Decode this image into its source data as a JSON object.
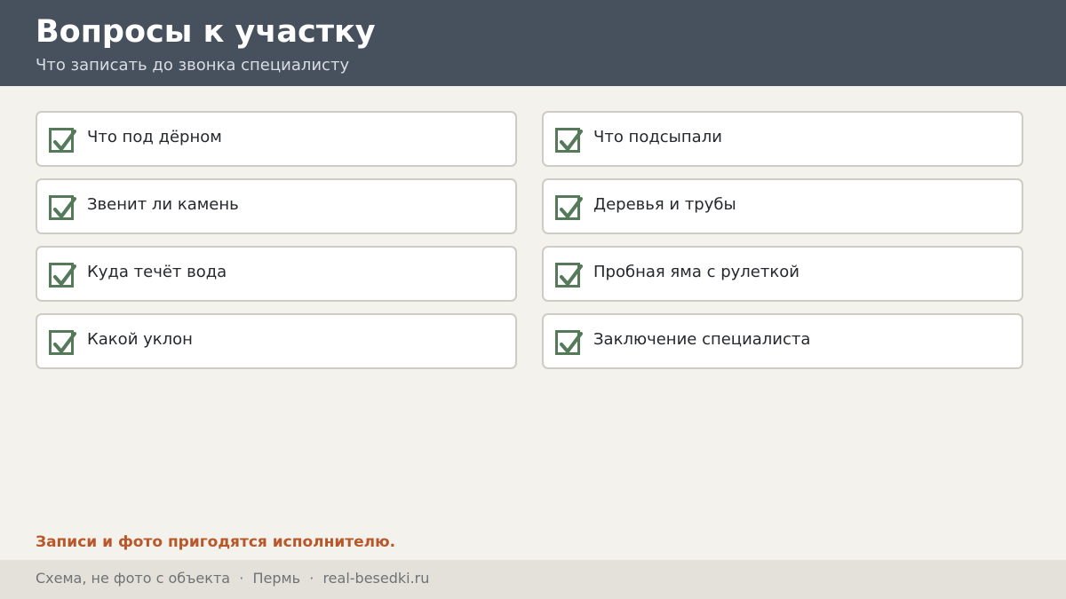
{
  "header": {
    "title": "Вопросы к участку",
    "subtitle": "Что записать до звонка специалисту"
  },
  "checklist": {
    "left": [
      {
        "label": "Что под дёрном",
        "checked": true
      },
      {
        "label": "Звенит ли камень",
        "checked": true
      },
      {
        "label": "Куда течёт вода",
        "checked": true
      },
      {
        "label": "Какой уклон",
        "checked": true
      }
    ],
    "right": [
      {
        "label": "Что подсыпали",
        "checked": true
      },
      {
        "label": "Деревья и трубы",
        "checked": true
      },
      {
        "label": "Пробная яма с рулеткой",
        "checked": true
      },
      {
        "label": "Заключение специалиста",
        "checked": true
      }
    ]
  },
  "note": "Записи и фото пригодятся исполнителю.",
  "footer": {
    "text": "Схема, не фото с объекта  ·  Пермь  ·  real-besedki.ru"
  },
  "colors": {
    "header_bg": "#47515e",
    "check": "#547a5a",
    "note": "#b8582a",
    "footer_bg": "#e4e1da"
  },
  "icons": {
    "checkbox": "checkmark-icon"
  }
}
